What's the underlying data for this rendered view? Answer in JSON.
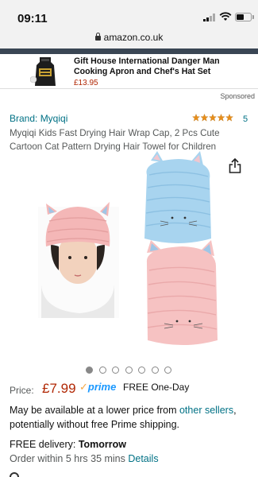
{
  "status": {
    "time": "09:11"
  },
  "browser": {
    "url": "amazon.co.uk"
  },
  "ad": {
    "title": "Gift House International Danger Man Cooking Apron and Chef's Hat Set",
    "price": "£13.95",
    "sponsored": "Sponsored"
  },
  "product": {
    "brand": "Brand: Myqiqi",
    "rating": 5,
    "rating_count": "5",
    "title": "Myqiqi Kids Fast Drying Hair Wrap Cap, 2 Pcs Cute Cartoon Cat Pattern Drying Hair Towel for Children"
  },
  "gallery": {
    "image_count": 7,
    "active_index": 0
  },
  "price": {
    "label": "Price:",
    "value": "£7.99",
    "prime": "prime",
    "free_delivery": "FREE One-Day"
  },
  "lower_price": {
    "text_a": "May be available at a lower price from ",
    "link": "other sellers",
    "text_b": ", potentially without free Prime shipping."
  },
  "delivery": {
    "label": "FREE delivery: ",
    "day": "Tomorrow",
    "order_text": "Order within 5 hrs 35 mins ",
    "details_link": "Details"
  },
  "colors": {
    "link": "#007185",
    "price": "#b12704",
    "prime": "#1a98ff",
    "star": "#e88e1a",
    "navstrip": "#3a4654"
  }
}
